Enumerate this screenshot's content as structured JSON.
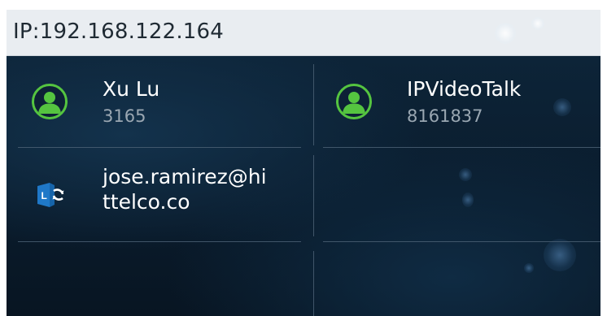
{
  "status_bar": {
    "ip_text": "IP:192.168.122.164"
  },
  "contacts": [
    {
      "name": "Xu Lu",
      "number": "3165",
      "icon": "person-icon"
    },
    {
      "name": "IPVideoTalk",
      "number": "8161837",
      "icon": "person-icon"
    }
  ],
  "lync_contact": {
    "line1": "jose.ramirez@hi",
    "line2": "ttelco.co",
    "icon": "lync-icon"
  },
  "colors": {
    "status_bar_bg": "#e9edf1",
    "accent_green": "#55c440",
    "background": "#0d2438",
    "divider": "#4d6377"
  }
}
